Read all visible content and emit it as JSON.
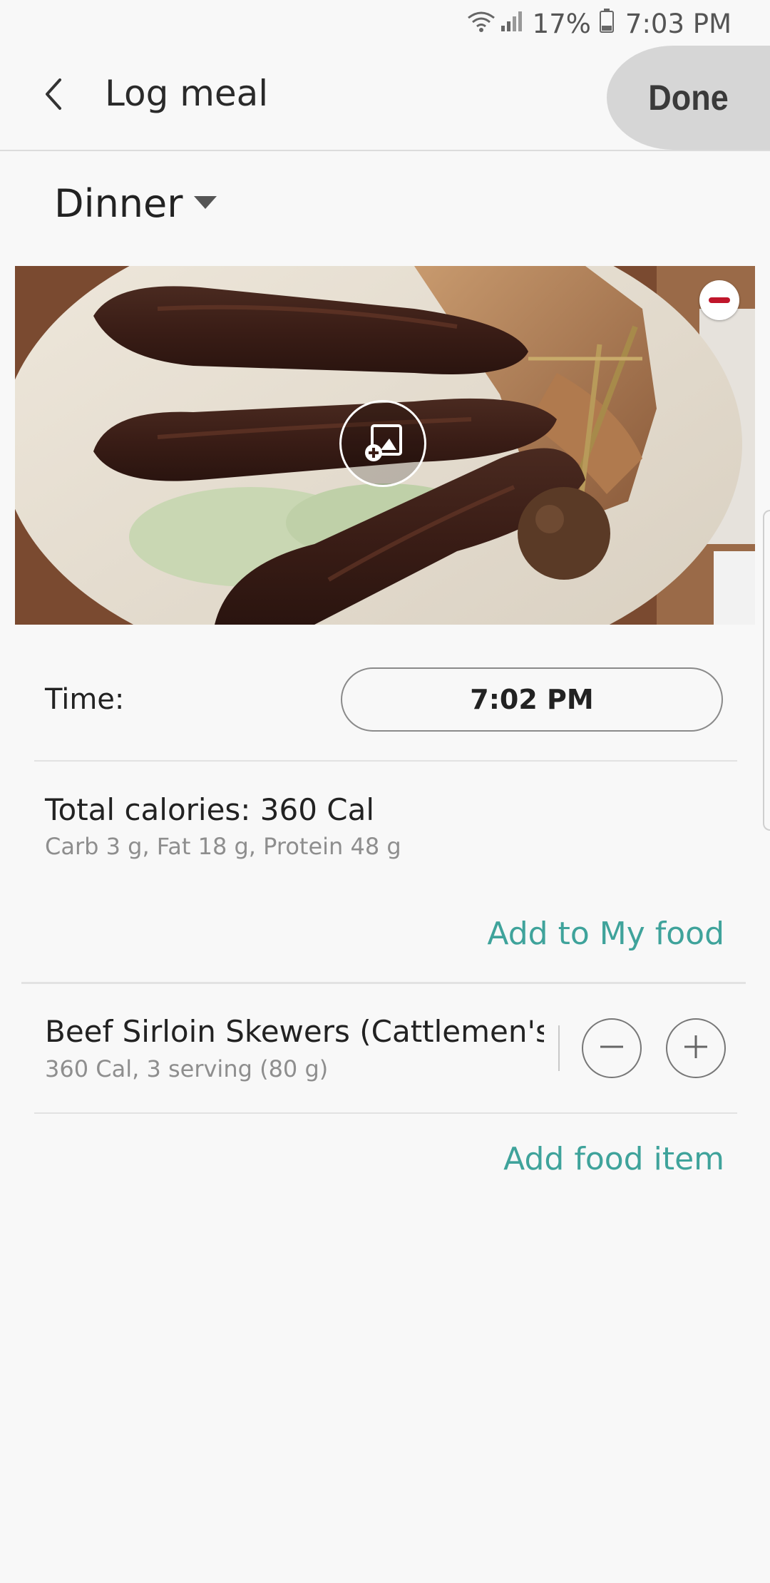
{
  "status_bar": {
    "battery_percent": "17%",
    "time": "7:03 PM",
    "icons": [
      "wifi-icon",
      "signal-icon",
      "battery-icon"
    ]
  },
  "app_bar": {
    "back_icon": "chevron-left-icon",
    "title": "Log meal",
    "done_label": "Done"
  },
  "meal": {
    "selected": "Dinner",
    "dropdown_icon": "triangle-down-icon"
  },
  "photo": {
    "remove_icon": "remove-circle-icon",
    "change_icon": "add-image-icon"
  },
  "time": {
    "label": "Time:",
    "value": "7:02 PM"
  },
  "calories": {
    "title": "Total calories: 360 Cal",
    "detail": "Carb 3 g, Fat 18 g, Protein 48 g"
  },
  "actions": {
    "add_to_my_food": "Add to My food",
    "add_food_item": "Add food item"
  },
  "food_items": [
    {
      "name": "Beef Sirloin Skewers (Cattlemen's...",
      "detail": "360 Cal, 3 serving (80 g)"
    }
  ],
  "colors": {
    "accent": "#3fa39b",
    "remove_red": "#c0162b",
    "done_bg": "#d6d6d6",
    "background": "#f8f8f8"
  }
}
